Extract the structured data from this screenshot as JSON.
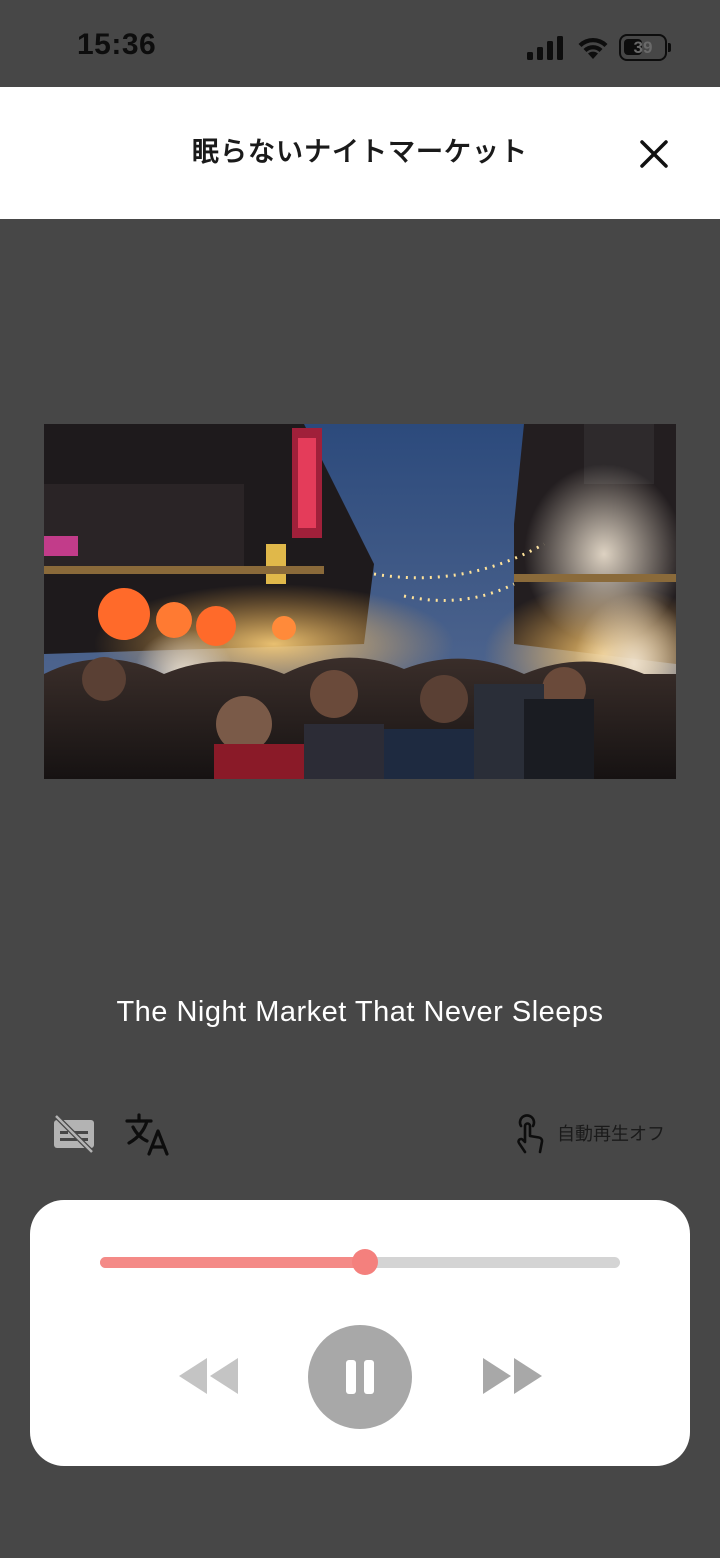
{
  "status_bar": {
    "time": "15:36",
    "battery_level": "39",
    "icons": [
      "signal-icon",
      "wifi-icon",
      "battery-icon"
    ]
  },
  "header": {
    "title": "眠らないナイトマーケット",
    "close_icon": "close-icon"
  },
  "media": {
    "subtitle": "The Night Market That Never Sleeps"
  },
  "toolbar": {
    "subtitles_icon": "subtitles-off-icon",
    "translate_icon": "translate-icon",
    "autoplay_icon": "touch-icon",
    "autoplay_label": "自動再生オフ"
  },
  "player": {
    "progress_percent": 51,
    "state": "playing",
    "controls": [
      "rewind-icon",
      "pause-icon",
      "fast-forward-icon"
    ]
  },
  "colors": {
    "background": "#474747",
    "progress_accent": "#f48a87",
    "progress_track": "#d4d4d4",
    "pause_button": "#a8a8a8"
  }
}
